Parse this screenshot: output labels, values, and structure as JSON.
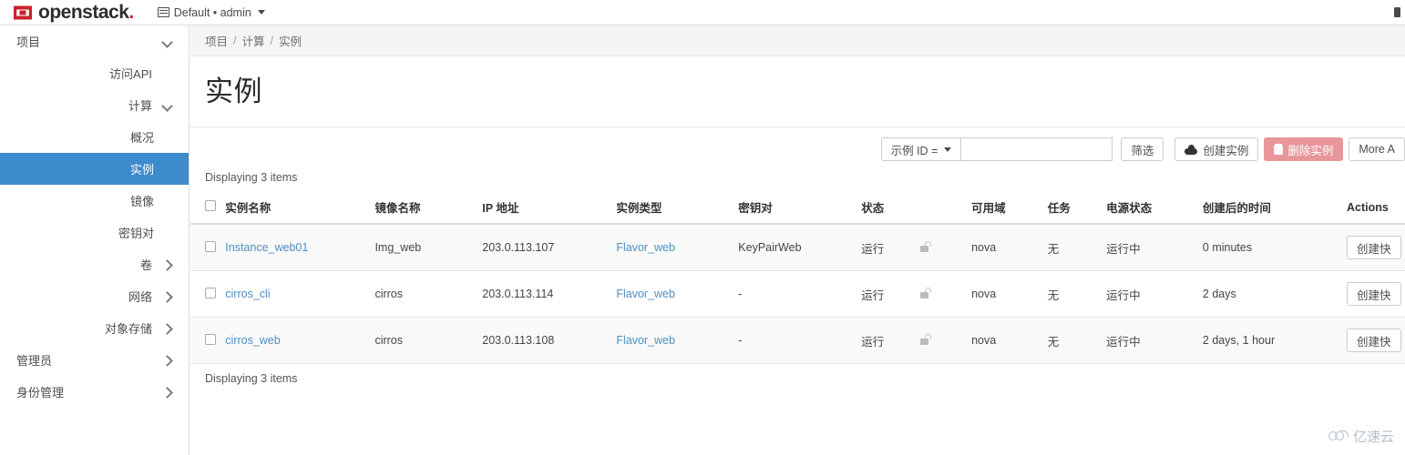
{
  "navbar": {
    "brand": "openstack",
    "brand_dot": ".",
    "brand_icon": "openstack-logo",
    "context_icon": "building-icon",
    "context_label": "Default • admin",
    "right_icon": "clipped-nav-icon"
  },
  "sidebar": {
    "items": [
      {
        "label": "项目",
        "level": 0,
        "chevron": "down",
        "active": false,
        "name": "sidebar-item-project"
      },
      {
        "label": "访问API",
        "level": 1,
        "chevron": "none",
        "active": false,
        "name": "sidebar-item-api-access"
      },
      {
        "label": "计算",
        "level": 1,
        "chevron": "down",
        "active": false,
        "name": "sidebar-item-compute"
      },
      {
        "label": "概况",
        "level": 2,
        "chevron": "none",
        "active": false,
        "name": "sidebar-item-overview"
      },
      {
        "label": "实例",
        "level": 2,
        "chevron": "none",
        "active": true,
        "name": "sidebar-item-instances"
      },
      {
        "label": "镜像",
        "level": 2,
        "chevron": "none",
        "active": false,
        "name": "sidebar-item-images"
      },
      {
        "label": "密钥对",
        "level": 2,
        "chevron": "none",
        "active": false,
        "name": "sidebar-item-keypairs"
      },
      {
        "label": "卷",
        "level": 1,
        "chevron": "right",
        "active": false,
        "name": "sidebar-item-volumes"
      },
      {
        "label": "网络",
        "level": 1,
        "chevron": "right",
        "active": false,
        "name": "sidebar-item-network"
      },
      {
        "label": "对象存储",
        "level": 1,
        "chevron": "right",
        "active": false,
        "name": "sidebar-item-object-store"
      },
      {
        "label": "管理员",
        "level": 0,
        "chevron": "right",
        "active": false,
        "name": "sidebar-item-admin"
      },
      {
        "label": "身份管理",
        "level": 0,
        "chevron": "right",
        "active": false,
        "name": "sidebar-item-identity"
      }
    ]
  },
  "breadcrumb": {
    "items": [
      "项目",
      "计算",
      "实例"
    ],
    "separator": "/"
  },
  "page": {
    "title": "实例"
  },
  "toolbar": {
    "filter_field_label": "示例 ID =",
    "filter_input_value": "",
    "filter_input_placeholder": "",
    "filter_button_label": "筛选",
    "create_label": "创建实例",
    "create_icon": "cloud-upload-icon",
    "delete_label": "删除实例",
    "delete_icon": "trash-icon",
    "more_label": "More A",
    "delete_color": "#e8969b"
  },
  "table": {
    "count_top": "Displaying 3 items",
    "count_bottom": "Displaying 3 items",
    "headers": [
      "",
      "实例名称",
      "镜像名称",
      "IP 地址",
      "实例类型",
      "密钥对",
      "状态",
      "",
      "可用域",
      "任务",
      "电源状态",
      "创建后的时间",
      "Actions"
    ],
    "rows": [
      {
        "name": "Instance_web01",
        "image": "Img_web",
        "ip": "203.0.113.107",
        "flavor": "Flavor_web",
        "keypair": "KeyPairWeb",
        "status": "运行",
        "lock_icon": "unlocked-padlock-icon",
        "availability_zone": "nova",
        "task": "无",
        "power_state": "运行中",
        "uptime": "0 minutes",
        "action_label": "创建快"
      },
      {
        "name": "cirros_cli",
        "image": "cirros",
        "ip": "203.0.113.114",
        "flavor": "Flavor_web",
        "keypair": "-",
        "status": "运行",
        "lock_icon": "unlocked-padlock-icon",
        "availability_zone": "nova",
        "task": "无",
        "power_state": "运行中",
        "uptime": "2 days",
        "action_label": "创建快"
      },
      {
        "name": "cirros_web",
        "image": "cirros",
        "ip": "203.0.113.108",
        "flavor": "Flavor_web",
        "keypair": "-",
        "status": "运行",
        "lock_icon": "unlocked-padlock-icon",
        "availability_zone": "nova",
        "task": "无",
        "power_state": "运行中",
        "uptime": "2 days, 1 hour",
        "action_label": "创建快"
      }
    ]
  },
  "watermark": {
    "text": "亿速云",
    "icon": "cloud-logo-icon"
  },
  "colors": {
    "accent_blue": "#3d8bcd",
    "link_blue": "#4e8fc4",
    "brand_red": "#cc2229",
    "danger_muted": "#e8969b"
  }
}
